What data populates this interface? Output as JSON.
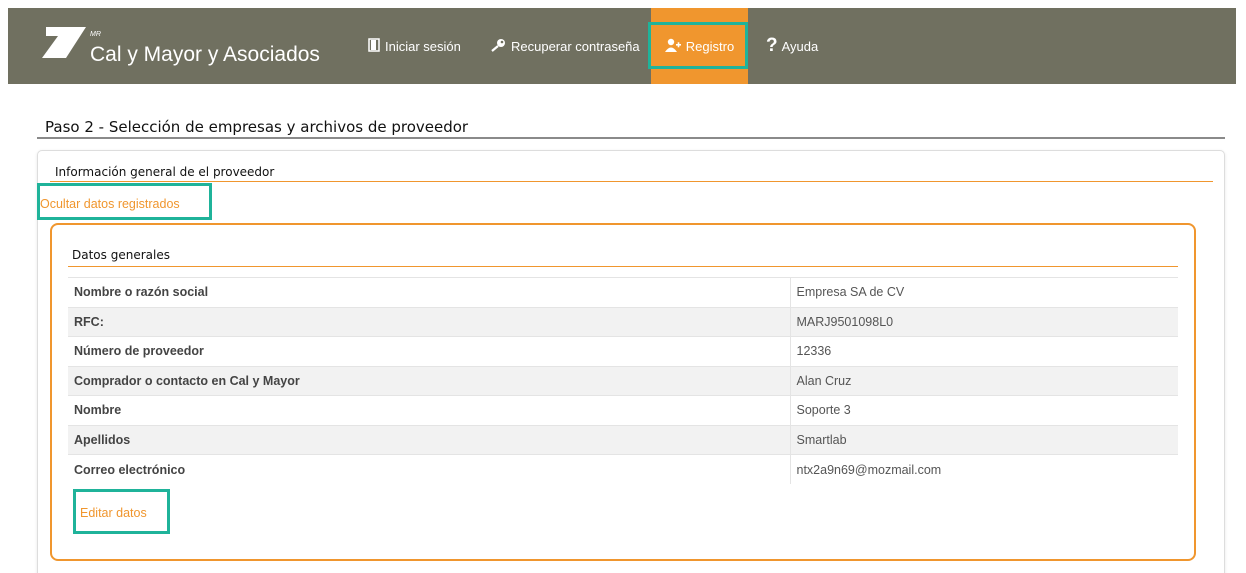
{
  "header": {
    "brand_sup": "MR",
    "brand_name": "Cal y Mayor y Asociados",
    "nav": [
      {
        "label": "Iniciar sesión",
        "icon": "door-icon"
      },
      {
        "label": "Recuperar contraseña",
        "icon": "key-icon"
      },
      {
        "label": "Registro",
        "icon": "user-plus-icon",
        "active": true
      },
      {
        "label": "Ayuda",
        "icon": "question-icon"
      }
    ]
  },
  "page": {
    "title": "Paso 2 - Selección de empresas y archivos de proveedor",
    "panel_heading": "Información general de el proveedor",
    "toggle_link": "Ocultar datos registrados",
    "section_heading": "Datos generales",
    "rows": [
      {
        "label": "Nombre o razón social",
        "value": "Empresa SA de CV"
      },
      {
        "label": "RFC:",
        "value": "MARJ9501098L0"
      },
      {
        "label": "Número de proveedor",
        "value": "12336"
      },
      {
        "label": "Comprador o contacto en Cal y Mayor",
        "value": "Alan Cruz"
      },
      {
        "label": "Nombre",
        "value": "Soporte 3"
      },
      {
        "label": "Apellidos",
        "value": "Smartlab"
      },
      {
        "label": "Correo electrónico",
        "value": "ntx2a9n69@mozmail.com"
      }
    ],
    "edit_link": "Editar datos"
  },
  "colors": {
    "navbar": "#707060",
    "accent": "#f0962e",
    "highlight": "#1fb39a"
  }
}
